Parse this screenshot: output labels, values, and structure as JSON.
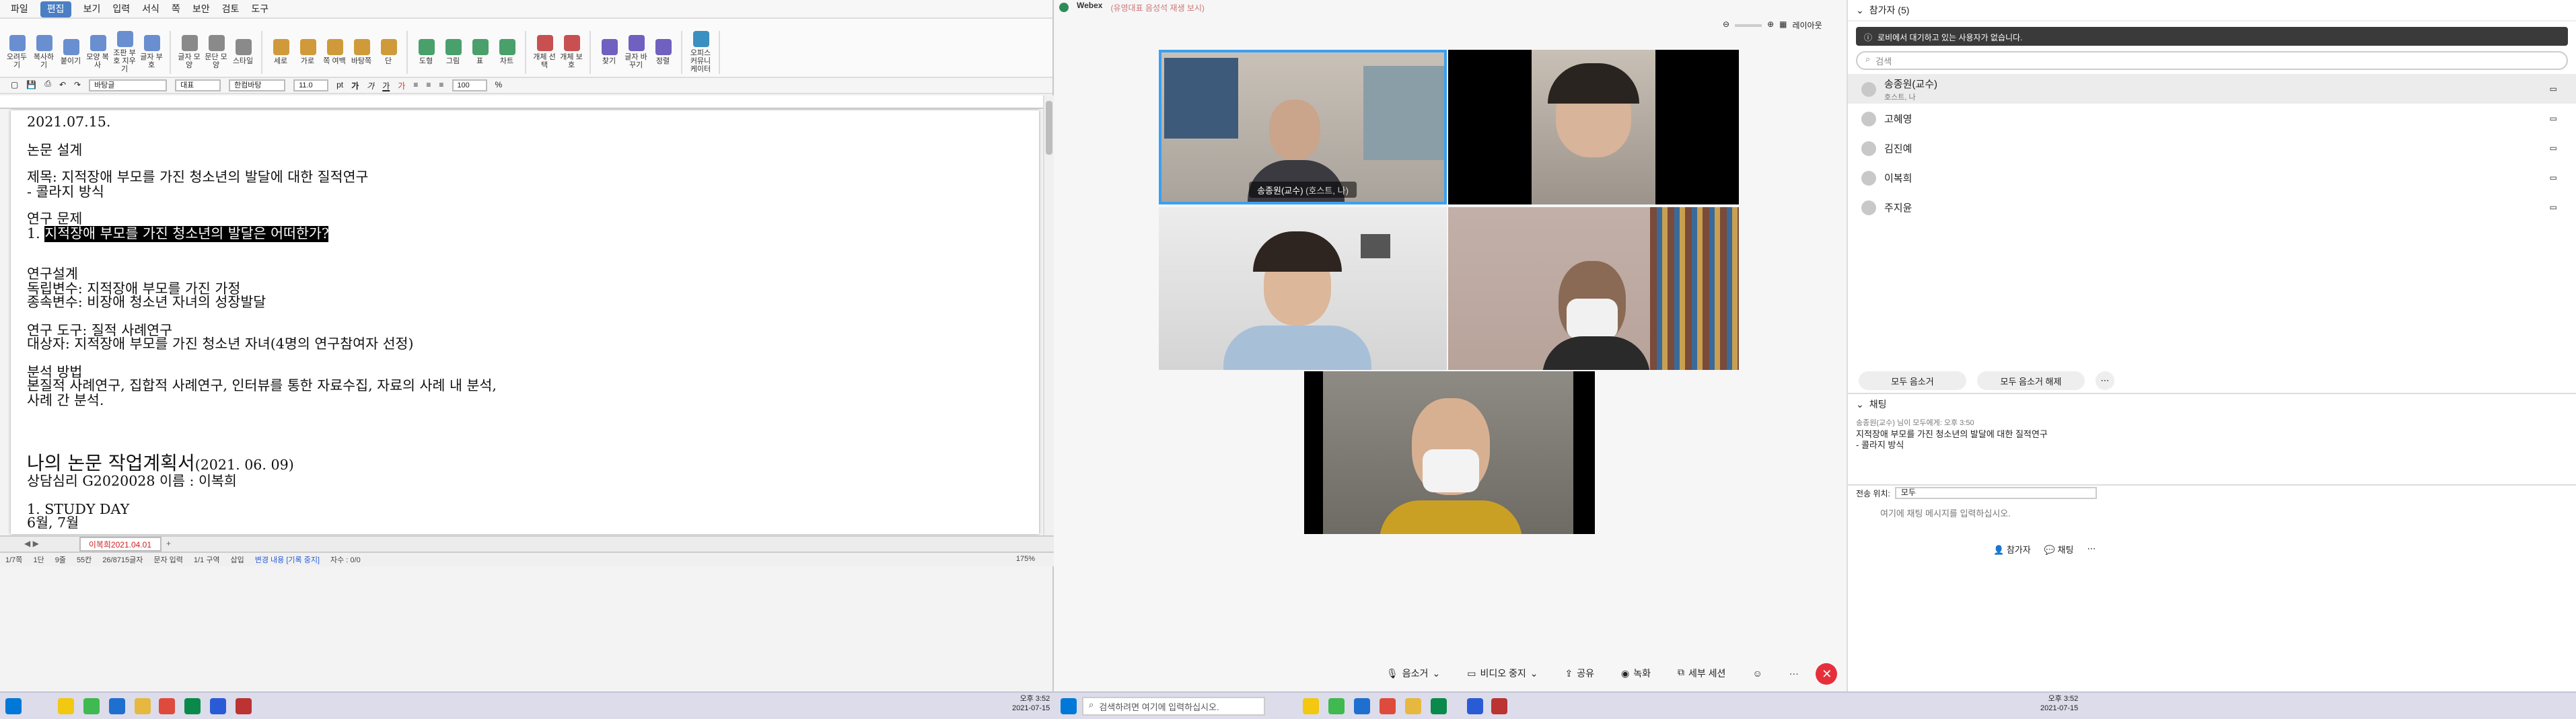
{
  "editor": {
    "menu": [
      "파일",
      "편집",
      "보기",
      "입력",
      "서식",
      "쪽",
      "보안",
      "검토",
      "도구"
    ],
    "active_menu_index": 1,
    "ribbon_groups": [
      [
        "오려두기",
        "복사하기",
        "붙이기",
        "모양 복사",
        "조판 부호 지우기",
        "글자 부호"
      ],
      [
        "글자 모양",
        "문단 모양",
        "스타일"
      ],
      [
        "세로",
        "가로",
        "쪽 여백",
        "바탕쪽",
        "단"
      ],
      [
        "도형",
        "그림",
        "표",
        "차트"
      ],
      [
        "개체 선택",
        "개체 보호"
      ],
      [
        "찾기",
        "글자 바꾸기",
        "정렬"
      ],
      [
        "오피스 커뮤니케이터"
      ]
    ],
    "format": {
      "style": "바탕글",
      "lang": "대표",
      "font": "한컴바탕",
      "size": "11.0",
      "unit": "pt",
      "zoom": "100",
      "zoom_unit": "%"
    },
    "doc_lines": [
      {
        "t": "2021.07.15.",
        "gap": 0
      },
      {
        "t": "논문 설계",
        "gap": 10
      },
      {
        "t": "제목: 지적장애 부모를 가진 청소년의 발달에 대한 질적연구",
        "gap": 10
      },
      {
        "t": "- 콜라지 방식",
        "gap": 0
      },
      {
        "t": "연구 문제",
        "gap": 10
      },
      {
        "t_pre": "1. ",
        "t_hl": "지적장애 부모를 가진 청소년의 발달은 어떠한가?",
        "gap": 0
      },
      {
        "t": "연구설계",
        "gap": 20
      },
      {
        "t": "독립변수: 지적장애 부모를 가진 가정",
        "gap": 0
      },
      {
        "t": "종속변수: 비장애 청소년 자녀의 성장발달",
        "gap": 0
      },
      {
        "t": "연구 도구: 질적 사례연구",
        "gap": 10
      },
      {
        "t": "대상자: 지적장애 부모를 가진 청소년 자녀(4명의 연구참여자 선정)",
        "gap": 0
      },
      {
        "t": "분석 방법",
        "gap": 10
      },
      {
        "t": "본질적 사례연구, 집합적 사례연구, 인터뷰를 통한 자료수집, 자료의 사례 내 분석,",
        "gap": 0
      },
      {
        "t": "사례 간 분석.",
        "gap": 0
      }
    ],
    "doc_big_title": "나의 논문 작업계획서",
    "doc_big_date": "(2021. 06. 09)",
    "doc_after": [
      {
        "t": "상담심리 G2020028 이름 : 이복희",
        "gap": 0
      },
      {
        "t": "1. STUDY DAY",
        "gap": 10
      },
      {
        "t": "6월, 7월",
        "gap": 0
      }
    ],
    "sheet_tab": "이복희2021.04.01",
    "status": [
      "1/7쪽",
      "1단",
      "9줄",
      "55칸",
      "26/8715글자",
      "문자 입력",
      "1/1 구역",
      "삽입",
      "변경 내용 [기록 중지]",
      "자수 : 0/0"
    ],
    "status_zoom": "175%"
  },
  "webex": {
    "app_title": "Webex",
    "meeting_title": "(유영대표 음성석 재생 보시)",
    "layout_button": "레이아웃",
    "host_label": "송종원(교수)",
    "host_suffix": "(호스트, 나)",
    "controls": {
      "mute": "음소거",
      "video": "비디오 중지",
      "share": "공유",
      "record": "녹화",
      "breakout": "세부 세션",
      "more": "···"
    }
  },
  "participants_panel": {
    "title": "참가자 (5)",
    "notice": "로비에서 대기하고 있는 사용자가 없습니다.",
    "search_placeholder": "검색",
    "participants": [
      {
        "name": "송종원(교수)",
        "sub": "호스트, 나"
      },
      {
        "name": "고혜영",
        "sub": ""
      },
      {
        "name": "김진예",
        "sub": ""
      },
      {
        "name": "이복희",
        "sub": ""
      },
      {
        "name": "주지윤",
        "sub": ""
      }
    ],
    "mute_all": "모두 음소거",
    "unmute_all": "모두 음소거 해제",
    "chat_title": "채팅",
    "chat_meta": "송종원(교수) 님이 모두에게:   오후 3:50",
    "chat_message_1": "지적장애 부모를 가진 청소년의 발달에 대한 질적연구",
    "chat_message_2": "- 콜라지 방식",
    "send_to_label": "전송 위치:",
    "send_to_value": "모두",
    "chat_placeholder": "여기에 채팅 메시지를 입력하십시오.",
    "footer_participants": "참가자",
    "footer_chat": "채팅"
  },
  "taskbar": {
    "search_placeholder": "검색하려면 여기에 입력하십시오.",
    "time": "오후 3:52",
    "date": "2021-07-15"
  },
  "colors": {
    "accent": "#4a7fc4",
    "end_call": "#e5303b",
    "highlight": "#000000",
    "tile_selected": "#3aa0f0"
  }
}
